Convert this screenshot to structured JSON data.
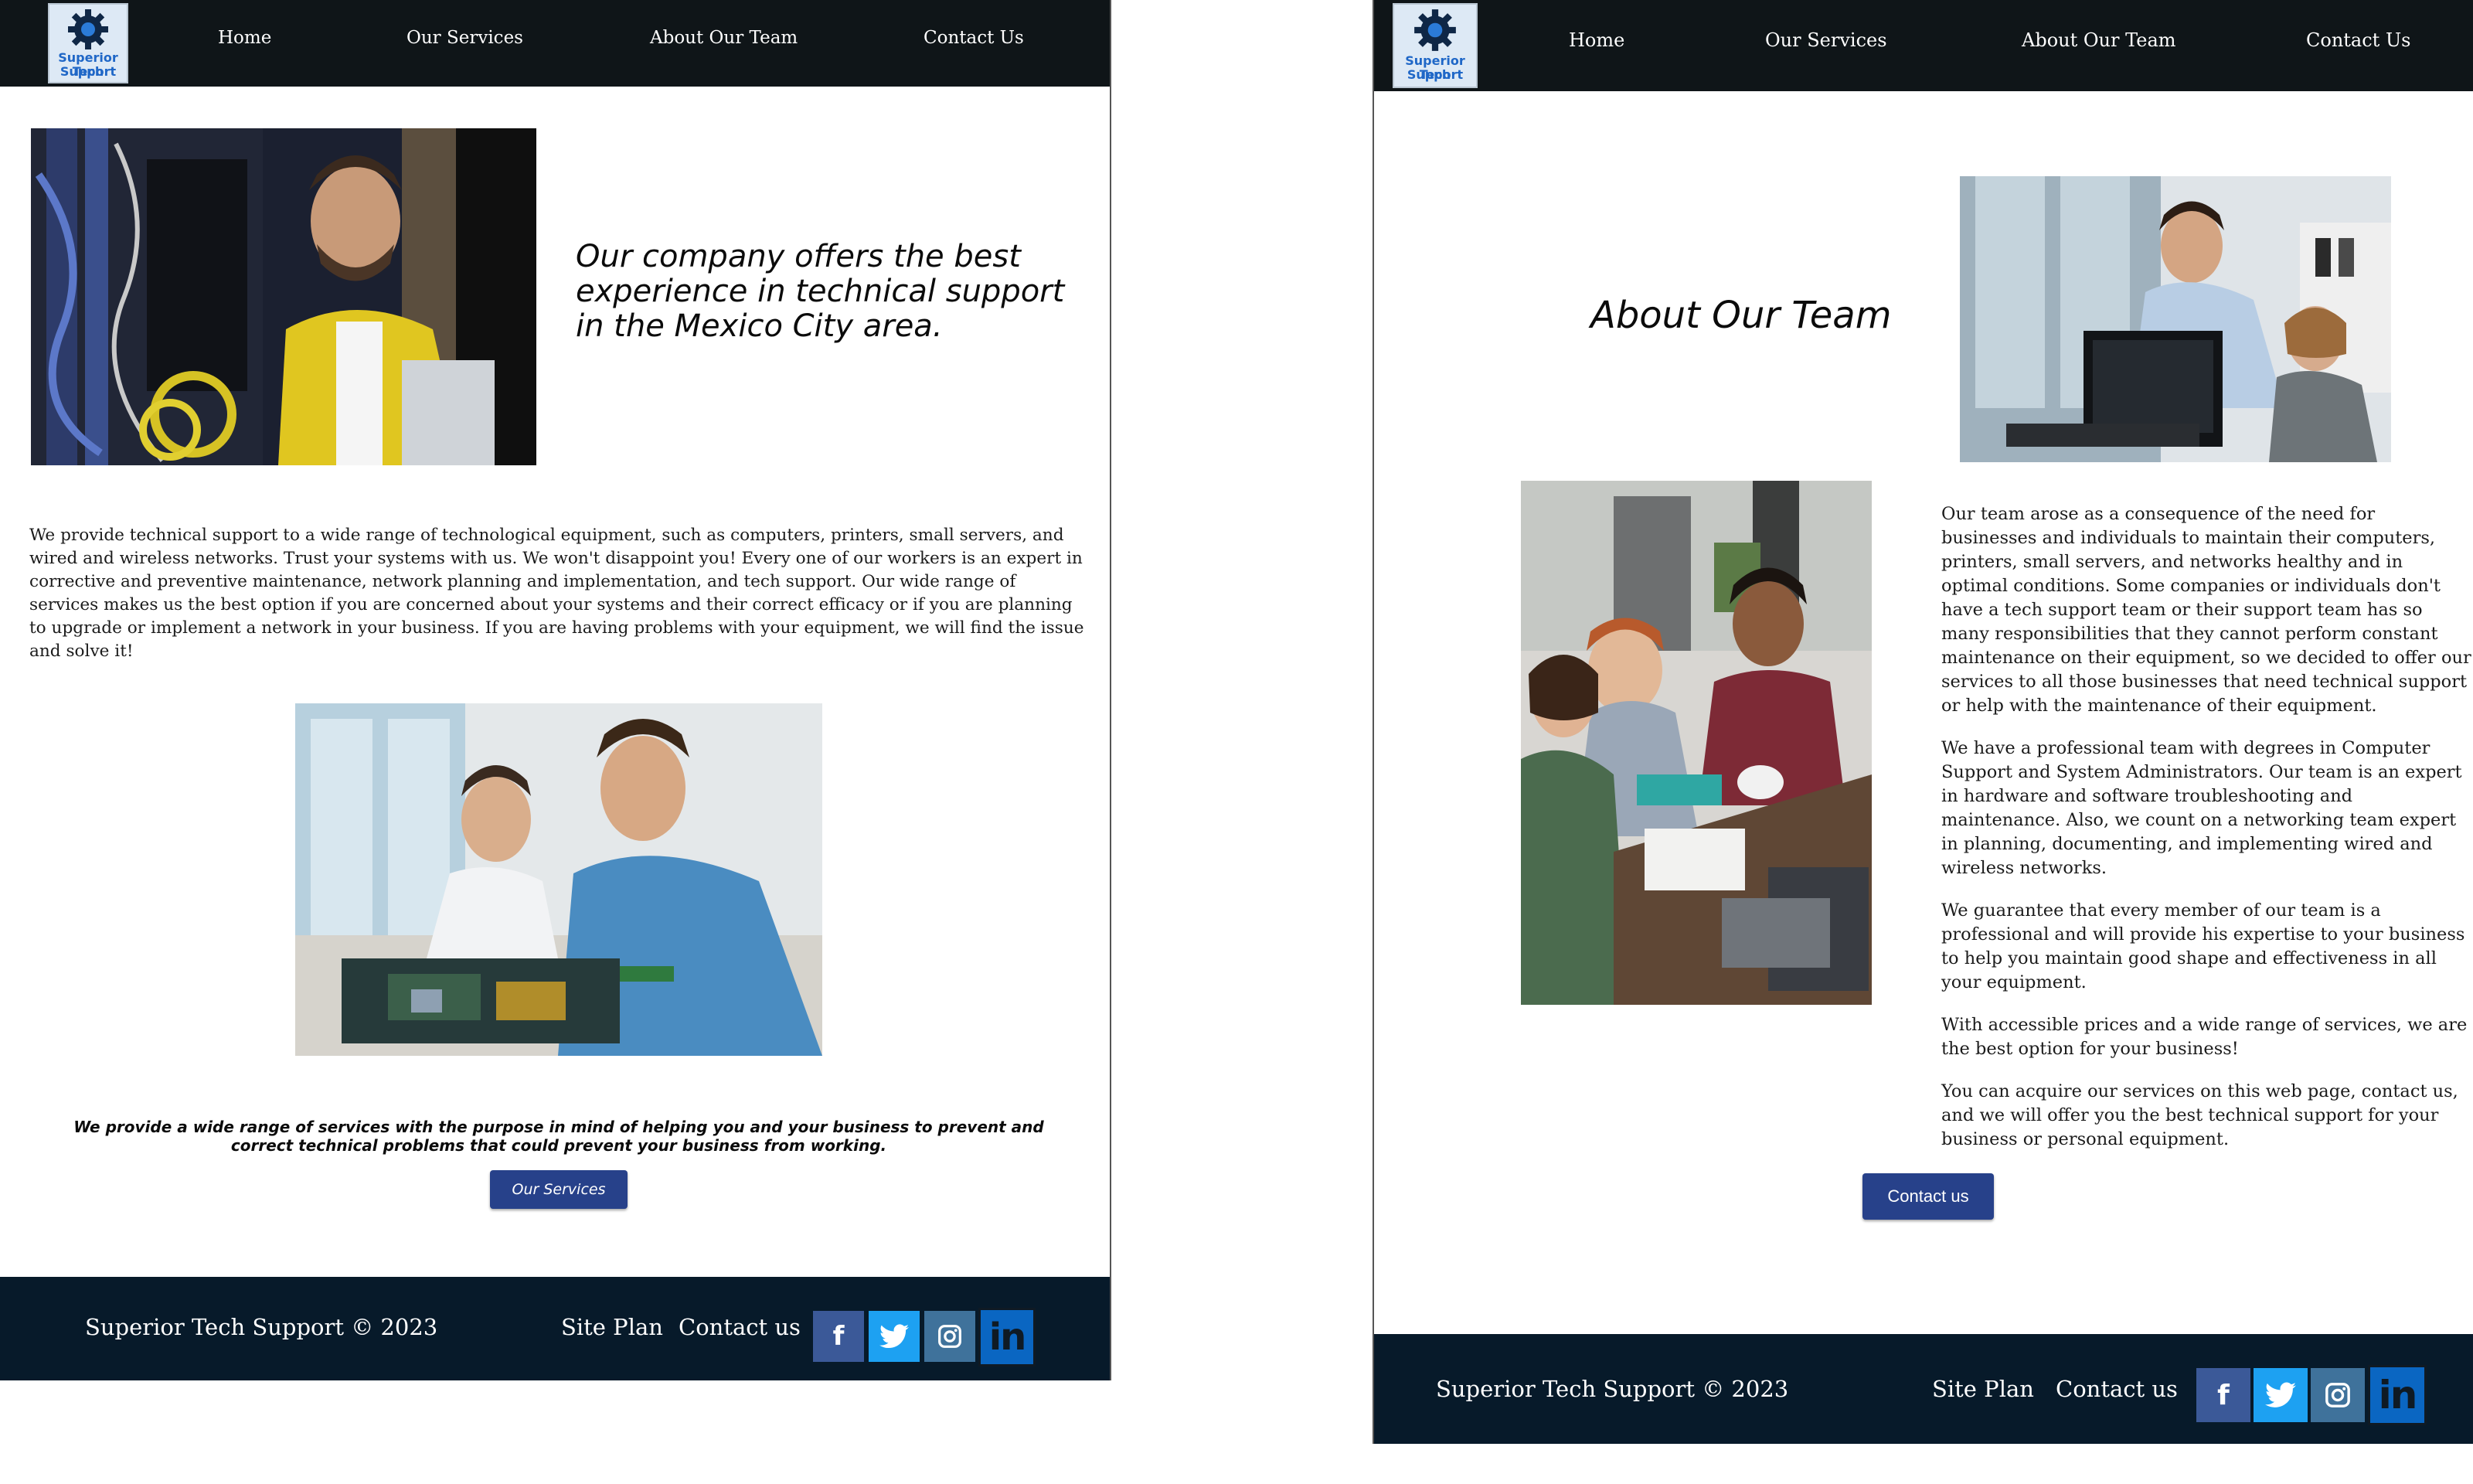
{
  "brand": {
    "logo_line1": "Superior Tech",
    "logo_line2": "Support"
  },
  "nav": {
    "home": "Home",
    "services": "Our Services",
    "about": "About Our Team",
    "contact": "Contact Us"
  },
  "home_page": {
    "hero_heading": "Our company offers the best experience in technical support in the Mexico City area.",
    "intro_paragraph": "We provide technical support to a wide range of technological equipment, such as computers, printers, small servers, and wired and wireless networks. Trust your systems with us. We won't disappoint you! Every one of our workers is an expert in corrective and preventive maintenance, network planning and implementation, and tech support. Our wide range of services makes us the best option if you are concerned about your systems and their correct efficacy or if you are planning to upgrade or implement a network in your business. If you are having problems with your equipment, we will find the issue and solve it!",
    "services_caption": "We provide a wide range of services with the purpose in mind of helping you and your business to prevent and correct technical problems that could prevent your business from working.",
    "services_button": "Our Services"
  },
  "about_page": {
    "heading": "About Our Team",
    "paragraphs": [
      "Our team arose as a consequence of the need for businesses and individuals to maintain their computers, printers, small servers, and networks healthy and in optimal conditions. Some companies or individuals don't have a tech support team or their support team has so many responsibilities that they cannot perform constant maintenance on their equipment, so we decided to offer our services to all those businesses that need technical support or help with the maintenance of their equipment.",
      "We have a professional team with degrees in Computer Support and System Administrators. Our team is an expert in hardware and software troubleshooting and maintenance. Also, we count on a networking team expert in planning, documenting, and implementing wired and wireless networks.",
      "We guarantee that every member of our team is a professional and will provide his expertise to your business to help you maintain good shape and effectiveness in all your equipment.",
      "With accessible prices and a wide range of services, we are the best option for your business!",
      "You can acquire our services on this web page, contact us, and we will offer you the best technical support for your business or personal equipment."
    ],
    "contact_button": "Contact us"
  },
  "footer": {
    "copyright": "Superior Tech Support © 2023",
    "site_plan": "Site Plan",
    "contact": "Contact us",
    "social": {
      "facebook": "f",
      "linkedin": "in"
    }
  },
  "colors": {
    "nav_bg": "#0f1518",
    "footer_bg": "#071a2a",
    "button_bg": "#27418a",
    "facebook": "#3b5998",
    "twitter": "#1da1f2",
    "instagram": "#3f729b",
    "linkedin": "#0077b5"
  },
  "icons": [
    "gear-logo-icon",
    "facebook-icon",
    "twitter-icon",
    "instagram-icon",
    "linkedin-icon"
  ]
}
